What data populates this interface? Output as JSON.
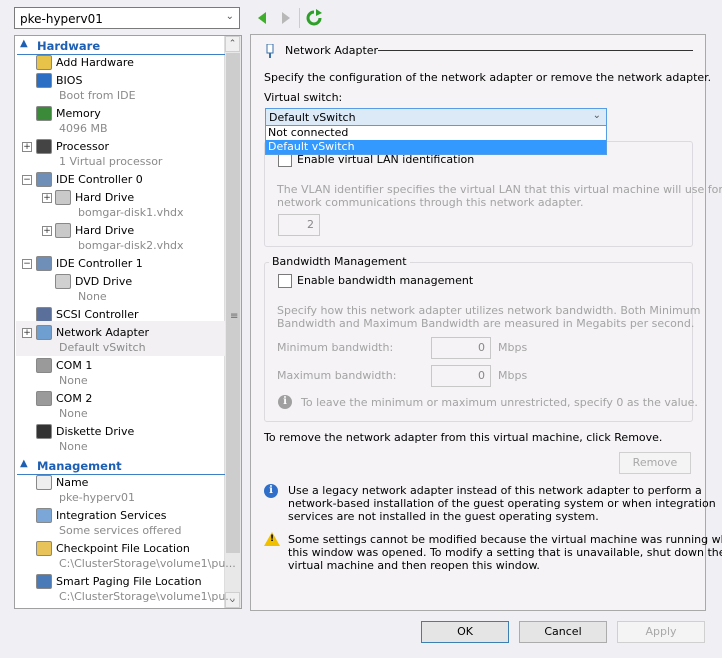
{
  "vm_selector": {
    "value": "pke-hyperv01"
  },
  "toolbar": {
    "back_icon": "back-arrow-icon",
    "forward_icon": "forward-arrow-icon",
    "refresh_icon": "refresh-icon"
  },
  "tree": {
    "sections": [
      {
        "label": "Hardware",
        "items": [
          {
            "title": "Add Hardware",
            "icon": "add-hardware-icon",
            "level": 1
          },
          {
            "title": "BIOS",
            "subtitle": "Boot from IDE",
            "icon": "bios-icon",
            "level": 1
          },
          {
            "title": "Memory",
            "subtitle": "4096 MB",
            "icon": "memory-icon",
            "level": 1
          },
          {
            "title": "Processor",
            "subtitle": "1 Virtual processor",
            "icon": "processor-icon",
            "level": 1,
            "expander": "+"
          },
          {
            "title": "IDE Controller 0",
            "icon": "ide-controller-icon",
            "level": 1,
            "expander": "−"
          },
          {
            "title": "Hard Drive",
            "subtitle": "bomgar-disk1.vhdx",
            "icon": "hard-drive-icon",
            "level": 2,
            "expander": "+"
          },
          {
            "title": "Hard Drive",
            "subtitle": "bomgar-disk2.vhdx",
            "icon": "hard-drive-icon",
            "level": 2,
            "expander": "+"
          },
          {
            "title": "IDE Controller 1",
            "icon": "ide-controller-icon",
            "level": 1,
            "expander": "−"
          },
          {
            "title": "DVD Drive",
            "subtitle": "None",
            "icon": "dvd-drive-icon",
            "level": 2
          },
          {
            "title": "SCSI Controller",
            "icon": "scsi-controller-icon",
            "level": 1
          },
          {
            "title": "Network Adapter",
            "subtitle": "Default vSwitch",
            "icon": "network-adapter-icon",
            "level": 1,
            "expander": "+",
            "selected": true
          },
          {
            "title": "COM 1",
            "subtitle": "None",
            "icon": "com-port-icon",
            "level": 1
          },
          {
            "title": "COM 2",
            "subtitle": "None",
            "icon": "com-port-icon",
            "level": 1
          },
          {
            "title": "Diskette Drive",
            "subtitle": "None",
            "icon": "diskette-icon",
            "level": 1
          }
        ]
      },
      {
        "label": "Management",
        "items": [
          {
            "title": "Name",
            "subtitle": "pke-hyperv01",
            "icon": "name-icon",
            "level": 1
          },
          {
            "title": "Integration Services",
            "subtitle": "Some services offered",
            "icon": "integration-services-icon",
            "level": 1
          },
          {
            "title": "Checkpoint File Location",
            "subtitle": "C:\\ClusterStorage\\volume1\\pu...",
            "icon": "checkpoint-folder-icon",
            "level": 1
          },
          {
            "title": "Smart Paging File Location",
            "subtitle": "C:\\ClusterStorage\\volume1\\pu...",
            "icon": "smart-paging-icon",
            "level": 1
          }
        ]
      }
    ]
  },
  "pane": {
    "title": "Network Adapter",
    "description": "Specify the configuration of the network adapter or remove the network adapter.",
    "virtual_switch_label": "Virtual switch:",
    "virtual_switch_value": "Default vSwitch",
    "virtual_switch_options": [
      "Not connected",
      "Default vSwitch"
    ],
    "vlan": {
      "checkbox_label": "Enable virtual LAN identification",
      "checked": false,
      "help_line1": "The VLAN identifier specifies the virtual LAN that this virtual machine will use for all",
      "help_line2": "network communications through this network adapter.",
      "id_value": "2"
    },
    "bandwidth": {
      "group_label": "Bandwidth Management",
      "checkbox_label": "Enable bandwidth management",
      "checked": false,
      "help_line1": "Specify how this network adapter utilizes network bandwidth. Both Minimum",
      "help_line2": "Bandwidth and Maximum Bandwidth are measured in Megabits per second.",
      "min_label": "Minimum bandwidth:",
      "min_value": "0",
      "max_label": "Maximum bandwidth:",
      "max_value": "0",
      "unit": "Mbps",
      "note": "To leave the minimum or maximum unrestricted, specify 0 as the value."
    },
    "remove_text": "To remove the network adapter from this virtual machine, click Remove.",
    "remove_button": "Remove",
    "info_lines": [
      "Use a legacy network adapter instead of this network adapter to perform a",
      "network-based installation of the guest operating system or when integration",
      "services are not installed in the guest operating system."
    ],
    "warning_lines": [
      "Some settings cannot be modified because the virtual machine was running when",
      "this window was opened. To modify a setting that is unavailable, shut down the",
      "virtual machine and then reopen this window."
    ]
  },
  "footer": {
    "ok": "OK",
    "cancel": "Cancel",
    "apply": "Apply"
  },
  "colors": {
    "accent": "#1e5fb3",
    "selection": "#3399ff"
  }
}
